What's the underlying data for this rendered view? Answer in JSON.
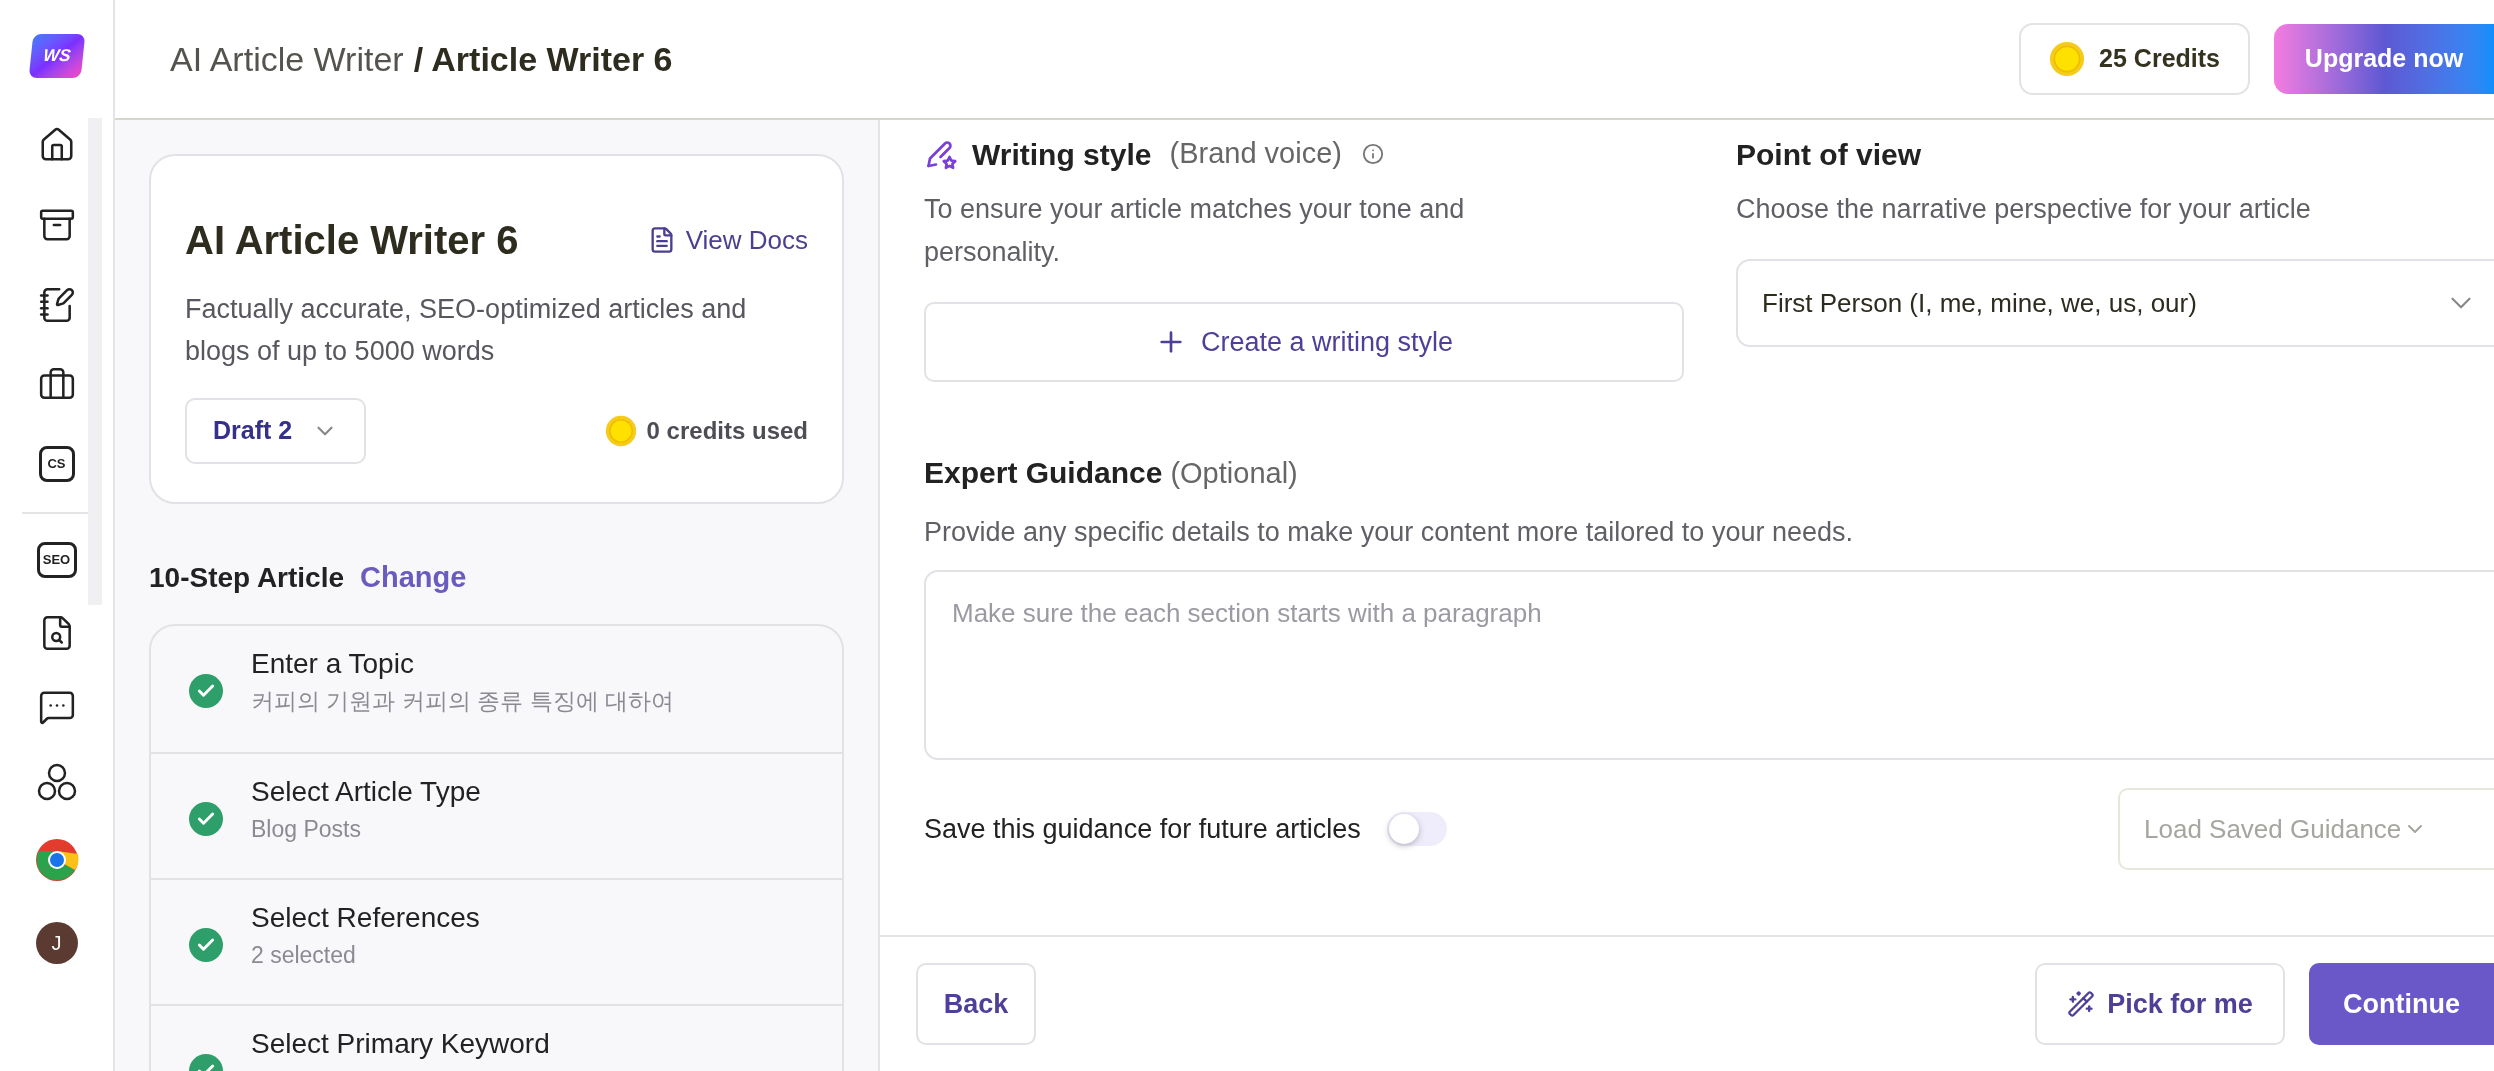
{
  "sidebar": {
    "logo": "WS",
    "cs_badge": "CS",
    "seo_badge": "SEO",
    "avatar": "J"
  },
  "header": {
    "parent": "AI Article Writer",
    "separator": "/",
    "current": "Article Writer 6",
    "credits": "25 Credits",
    "upgrade": "Upgrade now"
  },
  "article_card": {
    "title": "AI Article Writer 6",
    "view_docs": "View Docs",
    "description": "Factually accurate, SEO-optimized articles and blogs of up to 5000 words",
    "draft": "Draft 2",
    "credits_used": "0 credits used"
  },
  "steps": {
    "title": "10-Step Article",
    "change": "Change",
    "items": [
      {
        "title": "Enter a Topic",
        "detail": "커피의 기원과 커피의 종류 특징에 대하여",
        "completed": true
      },
      {
        "title": "Select Article Type",
        "detail": "Blog Posts",
        "completed": true
      },
      {
        "title": "Select References",
        "detail": "2 selected",
        "completed": true
      },
      {
        "title": "Select Primary Keyword",
        "completed": true
      }
    ]
  },
  "writing_style": {
    "title": "Writing style",
    "qualifier": "(Brand voice)",
    "description": "To ensure your article matches your tone and personality.",
    "create_button": "Create a writing style"
  },
  "point_of_view": {
    "title": "Point of view",
    "description": "Choose the narrative perspective for your article",
    "value": "First Person (I, me, mine, we, us, our)"
  },
  "expert_guidance": {
    "title": "Expert Guidance",
    "qualifier": "(Optional)",
    "description": "Provide any specific details to make your content more tailored to your needs.",
    "placeholder": "Make sure the each section starts with a paragraph",
    "save_label": "Save this guidance for future articles",
    "save_toggle": {
      "on": false
    },
    "load_saved": "Load Saved Guidance"
  },
  "footer": {
    "back": "Back",
    "pick": "Pick for me",
    "continue": "Continue"
  }
}
